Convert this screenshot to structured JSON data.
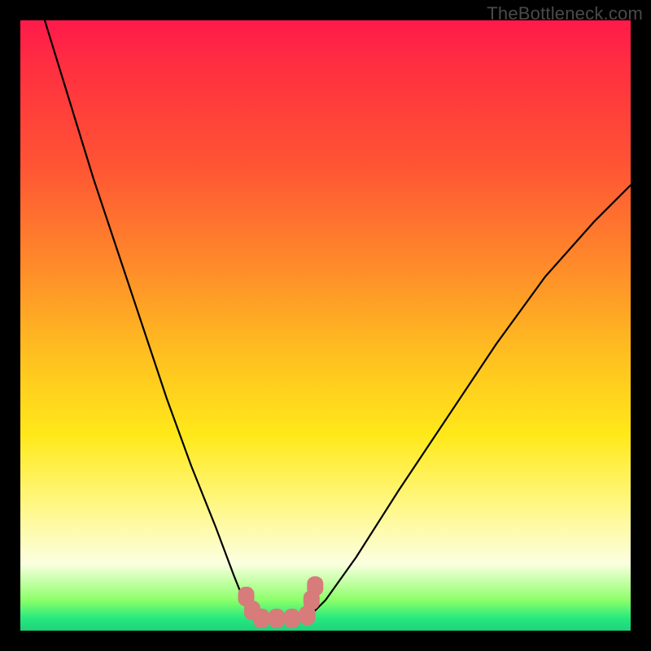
{
  "watermark": "TheBottleneck.com",
  "chart_data": {
    "type": "line",
    "title": "",
    "xlabel": "",
    "ylabel": "",
    "xlim": [
      0,
      100
    ],
    "ylim": [
      0,
      100
    ],
    "series": [
      {
        "name": "curve-left",
        "x": [
          4,
          8,
          12,
          16,
          20,
          24,
          28,
          32,
          35,
          37,
          38.5
        ],
        "y": [
          100,
          87,
          74,
          62,
          50,
          38,
          27,
          17,
          9,
          4,
          2
        ]
      },
      {
        "name": "flat-valley",
        "x": [
          38.5,
          47
        ],
        "y": [
          2,
          2
        ]
      },
      {
        "name": "curve-right",
        "x": [
          47,
          50,
          55,
          62,
          70,
          78,
          86,
          94,
          100
        ],
        "y": [
          2,
          5,
          12,
          23,
          35,
          47,
          58,
          67,
          73
        ]
      }
    ],
    "markers": {
      "name": "valley-markers",
      "color": "#d77b7b",
      "points": [
        {
          "x": 37.0,
          "y": 5.6
        },
        {
          "x": 38.0,
          "y": 3.3
        },
        {
          "x": 39.5,
          "y": 2.0
        },
        {
          "x": 42.0,
          "y": 2.0
        },
        {
          "x": 44.5,
          "y": 2.0
        },
        {
          "x": 47.0,
          "y": 2.5
        },
        {
          "x": 47.7,
          "y": 5.0
        },
        {
          "x": 48.3,
          "y": 7.3
        }
      ]
    }
  }
}
